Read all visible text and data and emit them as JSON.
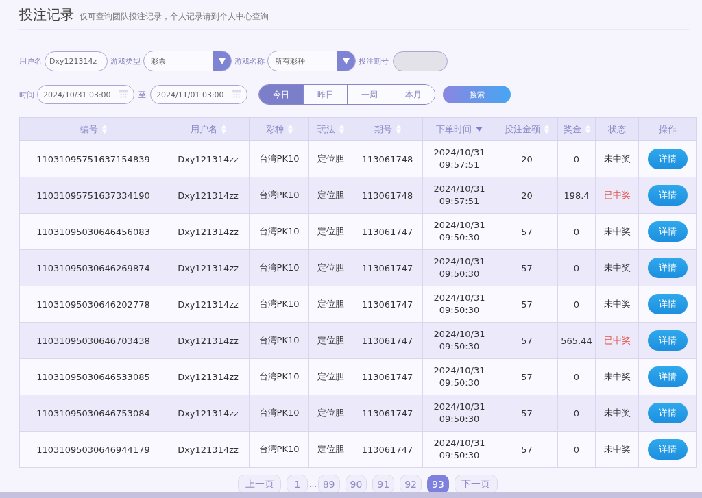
{
  "header": {
    "title": "投注记录",
    "subtitle": "仅可查询团队投注记录，个人记录请到个人中心查询"
  },
  "filters": {
    "username": {
      "label": "用户名",
      "value": "Dxy121314z"
    },
    "game_type": {
      "label": "游戏类型",
      "value": "彩票"
    },
    "game_name": {
      "label": "游戏名称",
      "value": "所有彩种"
    },
    "issue": {
      "label": "投注期号",
      "disabled": true
    },
    "time": {
      "label": "时间",
      "start": "2024/10/31 03:00",
      "separator": "至",
      "end": "2024/11/01 03:00"
    },
    "ranges": [
      {
        "label": "今日",
        "selected": true
      },
      {
        "label": "昨日",
        "selected": false
      },
      {
        "label": "一周",
        "selected": false
      },
      {
        "label": "本月",
        "selected": false
      }
    ],
    "search_button": "搜索"
  },
  "table": {
    "columns": [
      {
        "label": "编号",
        "kind": "sortable"
      },
      {
        "label": "用户名",
        "kind": "sortable"
      },
      {
        "label": "彩种",
        "kind": "sortable"
      },
      {
        "label": "玩法",
        "kind": "sortable"
      },
      {
        "label": "期号",
        "kind": "sortable"
      },
      {
        "label": "下单时间",
        "kind": "sorted"
      },
      {
        "label": "投注金额",
        "kind": "sortable"
      },
      {
        "label": "奖金",
        "kind": "sortable"
      },
      {
        "label": "状态",
        "kind": "plain"
      },
      {
        "label": "操作",
        "kind": "plain"
      }
    ],
    "rows": [
      {
        "id": "11031095751637154839",
        "user": "Dxy121314zz",
        "lottery": "台湾PK10",
        "play": "定位胆",
        "issue": "113061748",
        "date": "2024/10/31",
        "time": "09:57:51",
        "amount": "20",
        "prize": "0",
        "status": "未中奖",
        "won": false,
        "action": "详情"
      },
      {
        "id": "11031095751637334190",
        "user": "Dxy121314zz",
        "lottery": "台湾PK10",
        "play": "定位胆",
        "issue": "113061748",
        "date": "2024/10/31",
        "time": "09:57:51",
        "amount": "20",
        "prize": "198.4",
        "status": "已中奖",
        "won": true,
        "action": "详情"
      },
      {
        "id": "11031095030646456083",
        "user": "Dxy121314zz",
        "lottery": "台湾PK10",
        "play": "定位胆",
        "issue": "113061747",
        "date": "2024/10/31",
        "time": "09:50:30",
        "amount": "57",
        "prize": "0",
        "status": "未中奖",
        "won": false,
        "action": "详情"
      },
      {
        "id": "11031095030646269874",
        "user": "Dxy121314zz",
        "lottery": "台湾PK10",
        "play": "定位胆",
        "issue": "113061747",
        "date": "2024/10/31",
        "time": "09:50:30",
        "amount": "57",
        "prize": "0",
        "status": "未中奖",
        "won": false,
        "action": "详情"
      },
      {
        "id": "11031095030646202778",
        "user": "Dxy121314zz",
        "lottery": "台湾PK10",
        "play": "定位胆",
        "issue": "113061747",
        "date": "2024/10/31",
        "time": "09:50:30",
        "amount": "57",
        "prize": "0",
        "status": "未中奖",
        "won": false,
        "action": "详情"
      },
      {
        "id": "11031095030646703438",
        "user": "Dxy121314zz",
        "lottery": "台湾PK10",
        "play": "定位胆",
        "issue": "113061747",
        "date": "2024/10/31",
        "time": "09:50:30",
        "amount": "57",
        "prize": "565.44",
        "status": "已中奖",
        "won": true,
        "action": "详情"
      },
      {
        "id": "11031095030646533085",
        "user": "Dxy121314zz",
        "lottery": "台湾PK10",
        "play": "定位胆",
        "issue": "113061747",
        "date": "2024/10/31",
        "time": "09:50:30",
        "amount": "57",
        "prize": "0",
        "status": "未中奖",
        "won": false,
        "action": "详情"
      },
      {
        "id": "11031095030646753084",
        "user": "Dxy121314zz",
        "lottery": "台湾PK10",
        "play": "定位胆",
        "issue": "113061747",
        "date": "2024/10/31",
        "time": "09:50:30",
        "amount": "57",
        "prize": "0",
        "status": "未中奖",
        "won": false,
        "action": "详情"
      },
      {
        "id": "11031095030646944179",
        "user": "Dxy121314zz",
        "lottery": "台湾PK10",
        "play": "定位胆",
        "issue": "113061747",
        "date": "2024/10/31",
        "time": "09:50:30",
        "amount": "57",
        "prize": "0",
        "status": "未中奖",
        "won": false,
        "action": "详情"
      }
    ]
  },
  "pagination": [
    {
      "kind": "prev",
      "label": "上一页",
      "selected": false
    },
    {
      "kind": "page",
      "label": "1",
      "selected": false
    },
    {
      "kind": "gap",
      "label": "..."
    },
    {
      "kind": "page",
      "label": "89",
      "selected": false
    },
    {
      "kind": "page",
      "label": "90",
      "selected": false
    },
    {
      "kind": "page",
      "label": "91",
      "selected": false
    },
    {
      "kind": "page",
      "label": "92",
      "selected": false
    },
    {
      "kind": "page",
      "label": "93",
      "selected": true
    },
    {
      "kind": "next",
      "label": "下一页",
      "selected": false
    }
  ]
}
